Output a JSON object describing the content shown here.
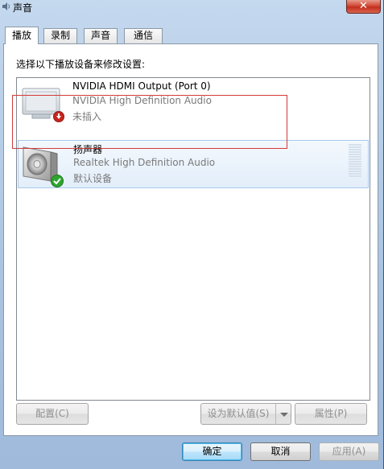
{
  "window": {
    "title": "声音",
    "close_glyph": "✕"
  },
  "tabs": [
    {
      "label": "播放",
      "active": true
    },
    {
      "label": "录制",
      "active": false
    },
    {
      "label": "声音",
      "active": false
    },
    {
      "label": "通信",
      "active": false
    }
  ],
  "instruction": "选择以下播放设备来修改设置:",
  "devices": [
    {
      "name": "NVIDIA HDMI Output (Port 0)",
      "driver": "NVIDIA High Definition Audio",
      "status": "未插入",
      "icon": "hdmi-monitor-icon",
      "badge": "unplugged-down-arrow-icon",
      "selected": false
    },
    {
      "name": "扬声器",
      "driver": "Realtek High Definition Audio",
      "status": "默认设备",
      "icon": "speaker-icon",
      "badge": "default-check-icon",
      "selected": true
    }
  ],
  "buttons": {
    "configure": "配置(C)",
    "set_default": "设为默认值(S)",
    "properties": "属性(P)",
    "ok": "确定",
    "cancel": "取消",
    "apply": "应用(A)"
  },
  "colors": {
    "selection_border": "#a9c9eb",
    "highlight_box": "#d43a3a",
    "check_green": "#2fa52f",
    "unplugged_red": "#c8261e"
  }
}
